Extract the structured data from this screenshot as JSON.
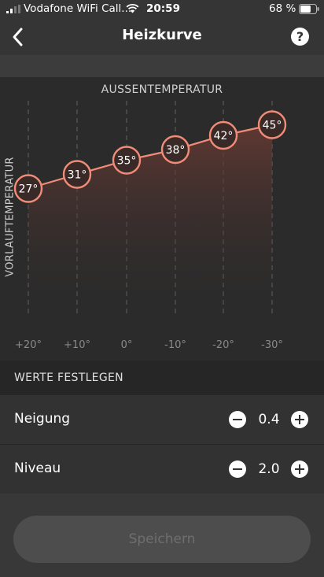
{
  "status_bar": {
    "carrier": "Vodafone WiFi Call...",
    "time": "20:59",
    "battery_percent": "68 %",
    "battery_level": 0.68
  },
  "nav": {
    "title": "Heizkurve",
    "help_label": "?"
  },
  "chart_data": {
    "type": "line",
    "title": "AUSSENTEMPERATUR",
    "ylabel": "VORLAUFTEMPERATUR",
    "x": [
      "+20°",
      "+10°",
      "0°",
      "-10°",
      "-20°",
      "-30°"
    ],
    "values": [
      27,
      31,
      35,
      38,
      42,
      45
    ],
    "value_labels": [
      "27°",
      "31°",
      "35°",
      "38°",
      "42°",
      "45°"
    ],
    "grid": "vertical dashed",
    "colors": {
      "line": "#f08c78",
      "fill": "#6a3a33",
      "panel": "#2b2b2b"
    }
  },
  "settings": {
    "section_title": "WERTE FESTLEGEN",
    "rows": [
      {
        "label": "Neigung",
        "value": "0.4"
      },
      {
        "label": "Niveau",
        "value": "2.0"
      }
    ]
  },
  "save_button": {
    "label": "Speichern",
    "enabled": false
  }
}
